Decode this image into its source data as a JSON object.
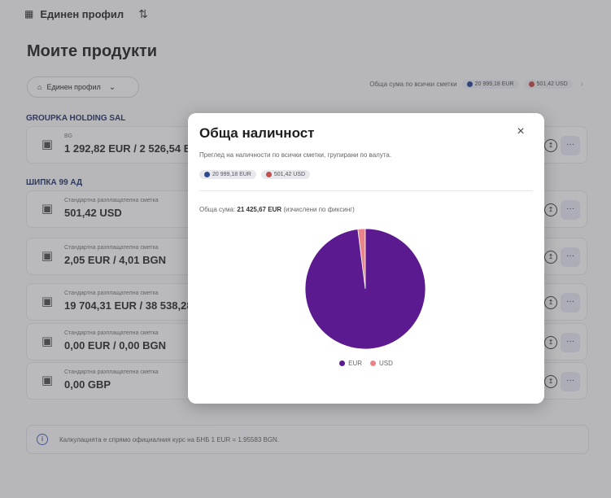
{
  "topbar": {
    "brand": "Единен профил"
  },
  "page": {
    "title": "Моите продукти"
  },
  "profile_select": {
    "label": "Единен профил"
  },
  "total_strip": {
    "label": "Обща сума по всички сметки",
    "chips": [
      {
        "text": "20 999,18 EUR",
        "color": "#2f4b8f"
      },
      {
        "text": "501,42 USD",
        "color": "#c0504d"
      }
    ]
  },
  "groups": [
    {
      "title": "GROUPKA HOLDING SAL",
      "accounts": [
        {
          "type": "BG",
          "amount": "1 292,82 EUR / 2 526,54 BG"
        }
      ]
    },
    {
      "title": "ШИПКА 99 АД",
      "accounts": [
        {
          "type": "Стандартна разплащателна сметка",
          "amount": "501,42 USD"
        },
        {
          "type": "Стандартна разплащателна сметка",
          "amount": "2,05 EUR / 4,01 BGN"
        },
        {
          "type": "Стандартна разплащателна сметка",
          "amount": "19 704,31 EUR / 38 538,28"
        },
        {
          "type": "Стандартна разплащателна сметка",
          "amount": "0,00 EUR / 0,00 BGN"
        },
        {
          "type": "Стандартна разплащателна сметка",
          "amount": "0,00 GBP"
        }
      ]
    }
  ],
  "info_banner": {
    "text": "Калкулацията е спрямо официалния курс на БНБ 1 EUR = 1.95583 BGN."
  },
  "modal": {
    "title": "Обща наличност",
    "close": "×",
    "description": "Преглед на наличности по всички сметки, групирани по валута.",
    "chips": [
      {
        "text": "20 999,18 EUR",
        "color": "#2f4b8f"
      },
      {
        "text": "501,42 USD",
        "color": "#c0504d"
      }
    ],
    "sum_label": "Обща сума:",
    "sum_value": "21 425,67 EUR",
    "sum_note": "(изчислени по фиксинг)"
  },
  "chart_data": {
    "type": "pie",
    "categories": [
      "EUR",
      "USD"
    ],
    "values": [
      20999.18,
      426.49
    ],
    "colors": [
      "#5b1a8f",
      "#e8848a"
    ],
    "legend": "bottom"
  }
}
